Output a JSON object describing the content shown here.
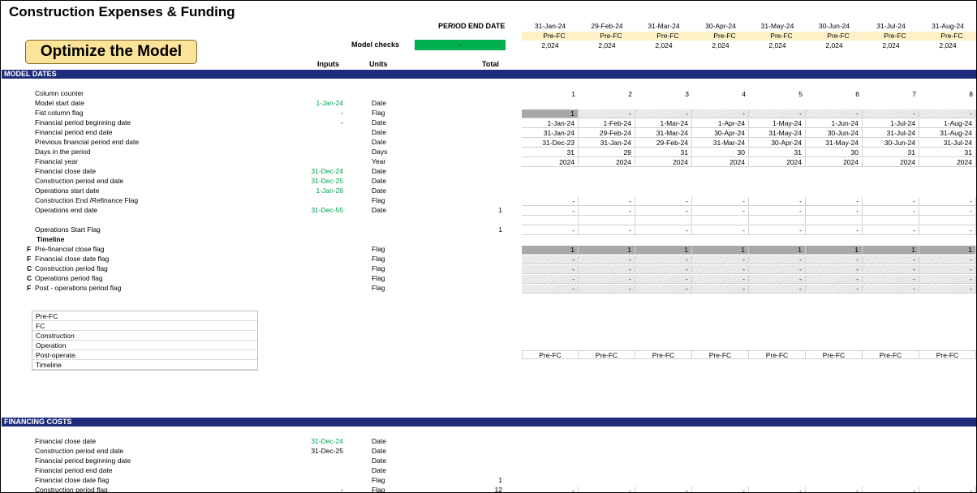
{
  "title": "Construction Expenses & Funding",
  "optimize_button": "Optimize the Model",
  "period_end_label": "PERIOD END DATE",
  "model_checks_label": "Model checks",
  "model_checks_value": "-",
  "col_headers": {
    "inputs": "Inputs",
    "units": "Units",
    "total": "Total"
  },
  "period_dates": [
    "31-Jan-24",
    "29-Feb-24",
    "31-Mar-24",
    "30-Apr-24",
    "31-May-24",
    "30-Jun-24",
    "31-Jul-24",
    "31-Aug-24"
  ],
  "period_phase": [
    "Pre-FC",
    "Pre-FC",
    "Pre-FC",
    "Pre-FC",
    "Pre-FC",
    "Pre-FC",
    "Pre-FC",
    "Pre-FC"
  ],
  "period_year": [
    "2,024",
    "2,024",
    "2,024",
    "2,024",
    "2,024",
    "2,024",
    "2,024",
    "2,024"
  ],
  "sections": {
    "model_dates": "MODEL DATES",
    "financing_costs": "FINANCING COSTS"
  },
  "rows": [
    {
      "label": "Column counter",
      "input": "",
      "unit": "",
      "total": "",
      "style": "plain",
      "values": [
        "1",
        "2",
        "3",
        "4",
        "5",
        "6",
        "7",
        "8"
      ]
    },
    {
      "label": "Model start date",
      "input": "1-Jan-24",
      "input_green": true,
      "unit": "Date",
      "total": "",
      "style": "none",
      "values": []
    },
    {
      "label": "Fist column flag",
      "input": "-",
      "unit": "Flag",
      "total": "",
      "style": "first",
      "values": [
        "1",
        "-",
        "-",
        "-",
        "-",
        "-",
        "-",
        "-"
      ]
    },
    {
      "label": "Financial period beginning date",
      "input": "-",
      "unit": "Date",
      "total": "",
      "style": "grid",
      "values": [
        "1-Jan-24",
        "1-Feb-24",
        "1-Mar-24",
        "1-Apr-24",
        "1-May-24",
        "1-Jun-24",
        "1-Jul-24",
        "1-Aug-24"
      ]
    },
    {
      "label": "Financial period end date",
      "input": "",
      "unit": "Date",
      "total": "",
      "style": "grid",
      "values": [
        "31-Jan-24",
        "29-Feb-24",
        "31-Mar-24",
        "30-Apr-24",
        "31-May-24",
        "30-Jun-24",
        "31-Jul-24",
        "31-Aug-24"
      ]
    },
    {
      "label": "Previous financial period end date",
      "input": "",
      "unit": "Date",
      "total": "",
      "style": "grid",
      "values": [
        "31-Dec-23",
        "31-Jan-24",
        "29-Feb-24",
        "31-Mar-24",
        "30-Apr-24",
        "31-May-24",
        "30-Jun-24",
        "31-Jul-24"
      ]
    },
    {
      "label": "Days in the period",
      "input": "",
      "unit": "Days",
      "total": "",
      "style": "grid",
      "values": [
        "31",
        "29",
        "31",
        "30",
        "31",
        "30",
        "31",
        "31"
      ]
    },
    {
      "label": "Financial year",
      "input": "",
      "unit": "Year",
      "total": "",
      "style": "grid",
      "values": [
        "2024",
        "2024",
        "2024",
        "2024",
        "2024",
        "2024",
        "2024",
        "2024"
      ]
    },
    {
      "label": "Financial close date",
      "input": "31-Dec-24",
      "input_green": true,
      "unit": "Date",
      "total": "",
      "style": "none",
      "values": []
    },
    {
      "label": "Construction period end date",
      "input": "31-Dec-25",
      "input_green": true,
      "unit": "Date",
      "total": "",
      "style": "none",
      "values": []
    },
    {
      "label": "Operations start date",
      "input": "1-Jan-26",
      "input_green": true,
      "unit": "Date",
      "total": "",
      "style": "none",
      "values": []
    },
    {
      "label": "Construction End /Refinance Flag",
      "input": "",
      "unit": "Flag",
      "total": "",
      "style": "grid",
      "values": [
        "-",
        "-",
        "-",
        "-",
        "-",
        "-",
        "-",
        "-"
      ]
    },
    {
      "label": "Operations end date",
      "input": "31-Dec-55",
      "input_green": true,
      "unit": "Date",
      "total": "1",
      "style": "grid",
      "values": [
        "-",
        "-",
        "-",
        "-",
        "-",
        "-",
        "-",
        "-"
      ]
    },
    {
      "label": "",
      "input": "",
      "unit": "",
      "total": "",
      "style": "grid",
      "values": [
        "",
        "",
        "",
        "",
        "",
        "",
        "",
        ""
      ]
    },
    {
      "label": "Operations Start Flag",
      "input": "",
      "unit": "",
      "total": "1",
      "style": "grid",
      "values": [
        "-",
        "-",
        "-",
        "-",
        "-",
        "-",
        "-",
        "-"
      ]
    },
    {
      "label": "Timeline",
      "bold": true,
      "input": "",
      "unit": "",
      "total": "",
      "style": "none",
      "values": []
    },
    {
      "label": "Pre-financial close flag",
      "mark": "F",
      "input": "",
      "unit": "Flag",
      "total": "",
      "style": "grayrow",
      "values": [
        "1",
        "1",
        "1",
        "1",
        "1",
        "1",
        "1",
        "1"
      ]
    },
    {
      "label": "Financial close date flag",
      "mark": "F",
      "input": "",
      "unit": "Flag",
      "total": "",
      "style": "hatch",
      "values": [
        "-",
        "-",
        "-",
        "-",
        "-",
        "-",
        "-",
        "-"
      ]
    },
    {
      "label": "Construction period flag",
      "mark": "C",
      "input": "",
      "unit": "Flag",
      "total": "",
      "style": "hatch",
      "values": [
        "-",
        "-",
        "-",
        "-",
        "-",
        "-",
        "-",
        "-"
      ]
    },
    {
      "label": "Operations period flag",
      "mark": "C",
      "input": "",
      "unit": "Flag",
      "total": "",
      "style": "hatch",
      "values": [
        "-",
        "-",
        "-",
        "-",
        "-",
        "-",
        "-",
        "-"
      ]
    },
    {
      "label": "Post - operations period flag",
      "mark": "F",
      "input": "",
      "unit": "Flag",
      "total": "",
      "style": "hatch",
      "values": [
        "-",
        "-",
        "-",
        "-",
        "-",
        "-",
        "-",
        "-"
      ]
    }
  ],
  "legend": [
    "Pre-FC",
    "FC",
    "Construction",
    "Operation",
    "Post-operate.",
    "Timeline"
  ],
  "timeline_values": [
    "Pre-FC",
    "Pre-FC",
    "Pre-FC",
    "Pre-FC",
    "Pre-FC",
    "Pre-FC",
    "Pre-FC",
    "Pre-FC"
  ],
  "fin_rows": [
    {
      "label": "Financial close date",
      "input": "31-Dec-24",
      "input_green": true,
      "unit": "Date",
      "total": ""
    },
    {
      "label": "Construction period end date",
      "input": "31-Dec-25",
      "input_green": false,
      "unit": "Date",
      "total": ""
    },
    {
      "label": "Financial period beginning date",
      "input": "",
      "unit": "Date",
      "total": ""
    },
    {
      "label": "Financial period end date",
      "input": "",
      "unit": "Date",
      "total": ""
    },
    {
      "label": "Financial close date flag",
      "input": "",
      "unit": "Flag",
      "total": "1"
    },
    {
      "label": "Construction period flag",
      "input": "-",
      "unit": "Flag",
      "total": "12",
      "values": [
        "-",
        "-",
        "-",
        "-",
        "-",
        "-",
        "-",
        "-"
      ]
    }
  ]
}
